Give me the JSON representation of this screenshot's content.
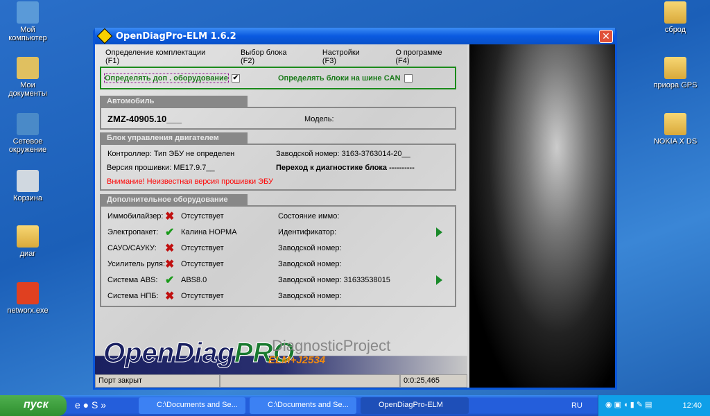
{
  "desktop": {
    "left_icons": [
      "Мой компьютер",
      "Мои документы",
      "Сетевое окружение",
      "Корзина",
      "диаг",
      "networx.exe"
    ],
    "right_icons": [
      "сброд",
      "приора GPS",
      "NOKIA X DS"
    ]
  },
  "window": {
    "title": "OpenDiagPro-ELM 1.6.2",
    "close": "✕"
  },
  "menu": [
    "Определение комплектации (F1)",
    "Выбор блока (F2)",
    "Настройки (F3)",
    "О программе (F4)"
  ],
  "options": {
    "detect_extra": "Определять доп . оборудование",
    "detect_extra_checked": true,
    "detect_can": "Определять блоки на шине CAN",
    "detect_can_checked": false,
    "check": "✔"
  },
  "car": {
    "header": "Автомобиль",
    "engine": "ZMZ-40905.10___",
    "model_label": "Модель:"
  },
  "ecu": {
    "header": "Блок управления  двигателем",
    "controller": "Контроллер:  Тип ЭБУ не определен",
    "serial": "Заводской номер:  3163-3763014-20__",
    "firmware": "Версия прошивки:  ME17.9.7__",
    "goto": "Переход к диагностике блока ----------",
    "warning": "Внимание! Неизвестная версия прошивки ЭБУ"
  },
  "extra": {
    "header": "Дополнительное оборудование",
    "rows": [
      {
        "label": "Иммобилайзер:",
        "ok": false,
        "value": "Отсутствует",
        "right": "Состояние иммо:",
        "arrow": false
      },
      {
        "label": "Электропакет:",
        "ok": true,
        "value": "Калина НОРМА",
        "right": "Идентификатор:",
        "arrow": true
      },
      {
        "label": "САУО/САУКУ:",
        "ok": false,
        "value": "Отсутствует",
        "right": "Заводской номер:",
        "arrow": false
      },
      {
        "label": "Усилитель руля:",
        "ok": false,
        "value": "Отсутствует",
        "right": "Заводской номер:",
        "arrow": false
      },
      {
        "label": "Система ABS:",
        "ok": true,
        "value": "ABS8.0",
        "right": "Заводской номер:  31633538015",
        "arrow": true
      },
      {
        "label": "Система НПБ:",
        "ok": false,
        "value": "Отсутствует",
        "right": "Заводской номер:",
        "arrow": false
      }
    ]
  },
  "brand": {
    "open": "OpenDiag",
    "pro": "PRO",
    "sub": "DiagnosticProject",
    "elm": "ELM+J2534"
  },
  "status": {
    "port": "Порт закрыт",
    "middle": "",
    "time": "0:0:25,465"
  },
  "taskbar": {
    "start": "пуск",
    "buttons": [
      "C:\\Documents and Se...",
      "C:\\Documents and Se...",
      "OpenDiagPro-ELM"
    ],
    "lang": "RU",
    "clock": "12:40"
  }
}
